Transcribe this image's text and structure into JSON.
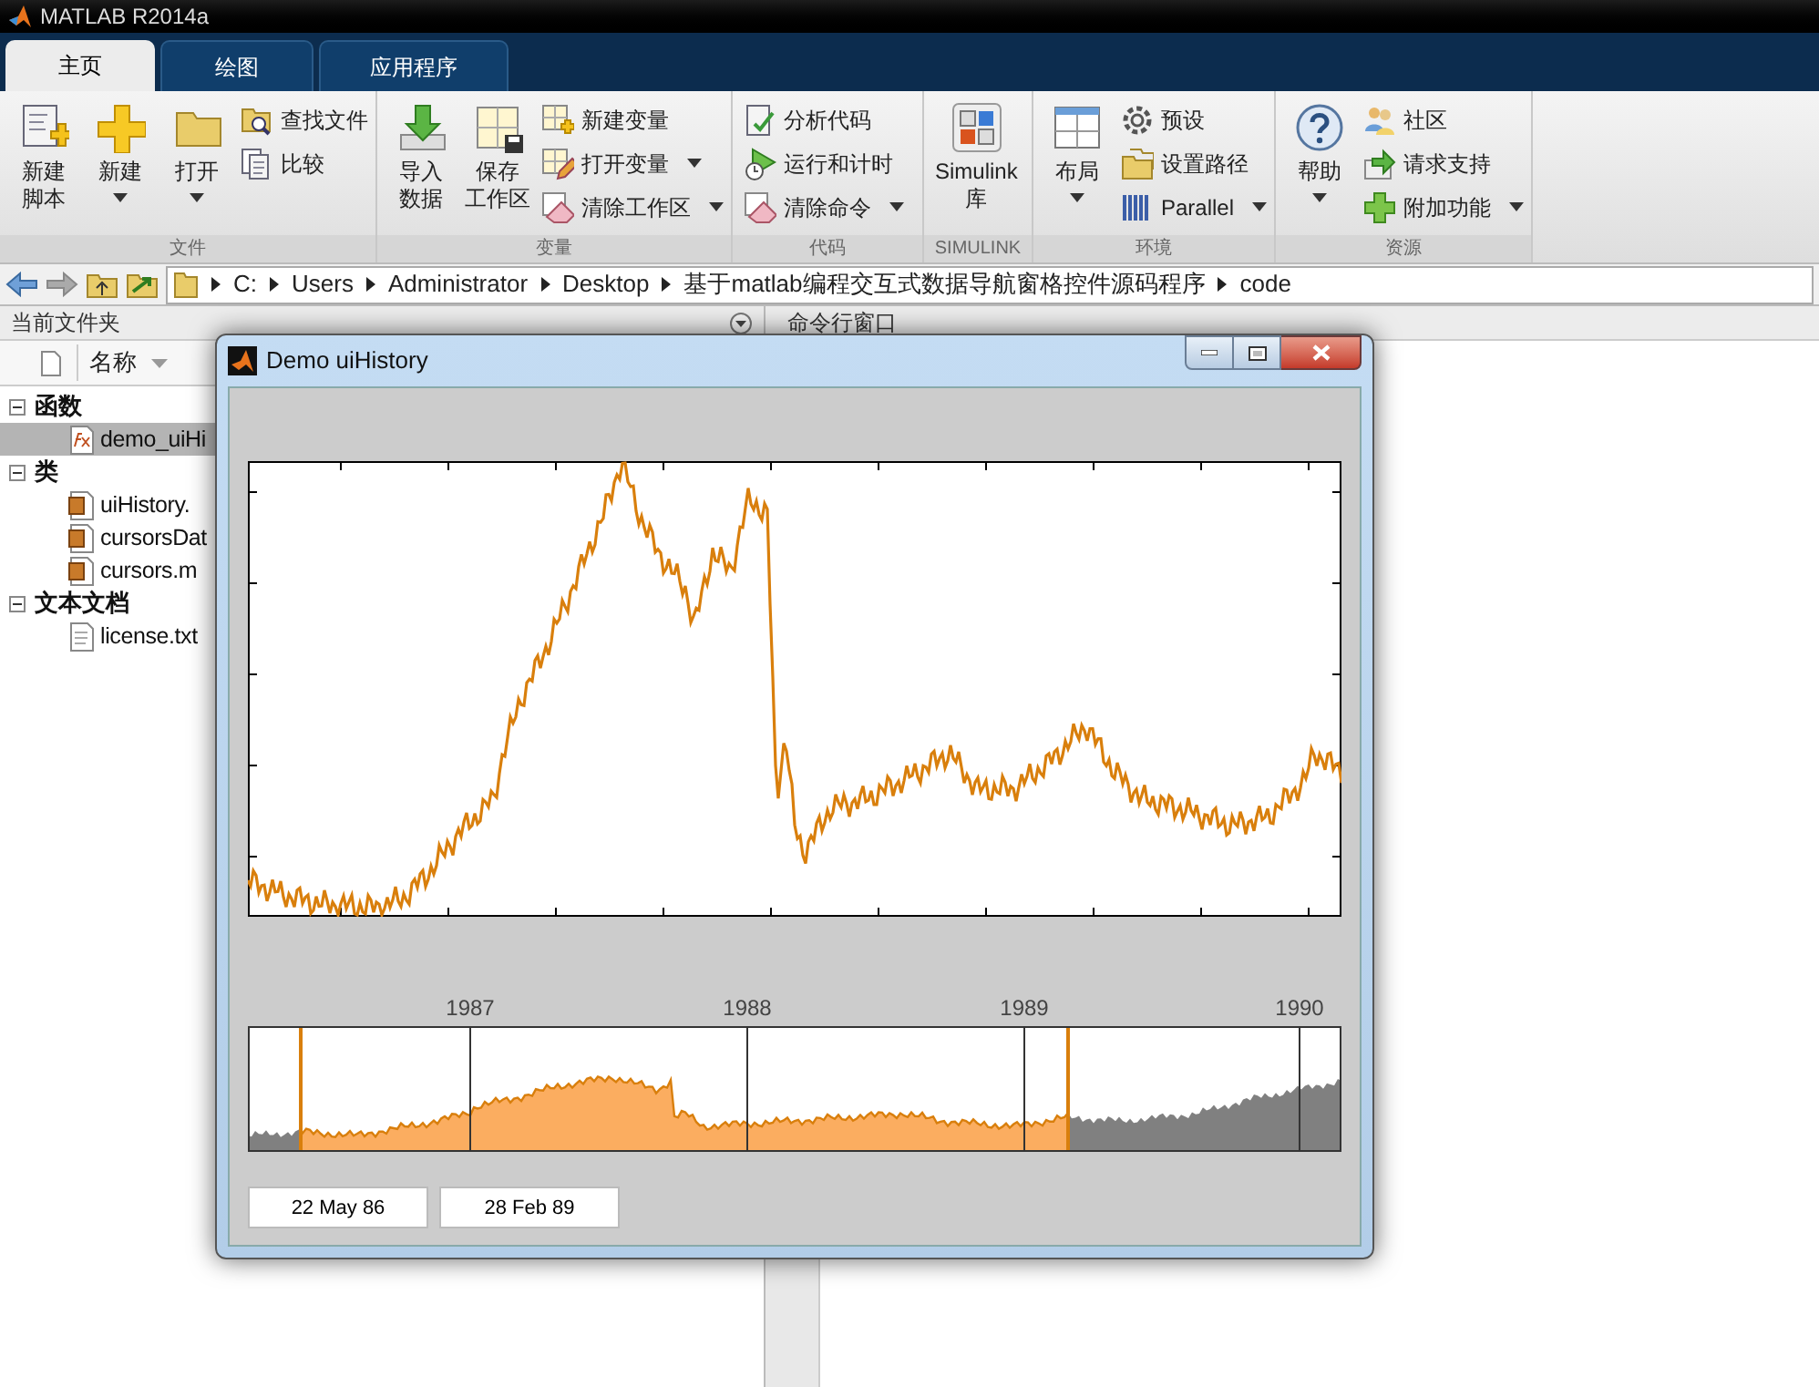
{
  "window": {
    "title": "MATLAB R2014a"
  },
  "tabs": [
    {
      "label": "主页",
      "selected": true
    },
    {
      "label": "绘图",
      "selected": false
    },
    {
      "label": "应用程序",
      "selected": false
    }
  ],
  "ribbon": {
    "groups": [
      {
        "label": "文件",
        "items": [
          {
            "kind": "large",
            "lines": [
              "新建",
              "脚本"
            ],
            "dropdown": false
          },
          {
            "kind": "large",
            "lines": [
              "新建"
            ],
            "dropdown": true
          },
          {
            "kind": "large",
            "lines": [
              "打开"
            ],
            "dropdown": true
          },
          {
            "kind": "small",
            "label": "查找文件",
            "dropdown": false
          },
          {
            "kind": "small",
            "label": "比较",
            "dropdown": false
          }
        ]
      },
      {
        "label": "变量",
        "items": [
          {
            "kind": "large",
            "lines": [
              "导入",
              "数据"
            ],
            "dropdown": false
          },
          {
            "kind": "large",
            "lines": [
              "保存",
              "工作区"
            ],
            "dropdown": false
          },
          {
            "kind": "small",
            "label": "新建变量",
            "dropdown": false
          },
          {
            "kind": "small",
            "label": "打开变量",
            "dropdown": true
          },
          {
            "kind": "small",
            "label": "清除工作区",
            "dropdown": true
          }
        ]
      },
      {
        "label": "代码",
        "items": [
          {
            "kind": "small",
            "label": "分析代码",
            "dropdown": false
          },
          {
            "kind": "small",
            "label": "运行和计时",
            "dropdown": false
          },
          {
            "kind": "small",
            "label": "清除命令",
            "dropdown": true
          }
        ]
      },
      {
        "label": "SIMULINK",
        "items": [
          {
            "kind": "large",
            "lines": [
              "Simulink",
              "库"
            ],
            "dropdown": false
          }
        ]
      },
      {
        "label": "环境",
        "items": [
          {
            "kind": "large",
            "lines": [
              "布局"
            ],
            "dropdown": true
          },
          {
            "kind": "small",
            "label": "预设",
            "dropdown": false
          },
          {
            "kind": "small",
            "label": "设置路径",
            "dropdown": false
          },
          {
            "kind": "small",
            "label": "Parallel",
            "dropdown": true
          }
        ]
      },
      {
        "label": "资源",
        "items": [
          {
            "kind": "large",
            "lines": [
              "帮助"
            ],
            "dropdown": true
          },
          {
            "kind": "small",
            "label": "社区",
            "dropdown": false
          },
          {
            "kind": "small",
            "label": "请求支持",
            "dropdown": false
          },
          {
            "kind": "small",
            "label": "附加功能",
            "dropdown": true
          }
        ]
      }
    ]
  },
  "path": [
    "C:",
    "Users",
    "Administrator",
    "Desktop",
    "基于matlab编程交互式数据导航窗格控件源码程序",
    "code"
  ],
  "current_folder": {
    "title": "当前文件夹",
    "column": "名称",
    "tree": [
      {
        "label": "函数",
        "expanded": true,
        "children": [
          {
            "label": "demo_uiHi",
            "selected": true
          }
        ]
      },
      {
        "label": "类",
        "expanded": true,
        "children": [
          {
            "label": "uiHistory.",
            "selected": false
          },
          {
            "label": "cursorsDat",
            "selected": false
          },
          {
            "label": "cursors.m",
            "selected": false
          }
        ]
      },
      {
        "label": "文本文档",
        "expanded": true,
        "children": [
          {
            "label": "license.txt",
            "selected": false
          }
        ]
      }
    ]
  },
  "command_window": {
    "title": "命令行窗口"
  },
  "figure": {
    "title": "Demo uiHistory",
    "year_labels": [
      "1987",
      "1988",
      "1989",
      "1990"
    ],
    "range_fields": [
      {
        "value": "22 May 86"
      },
      {
        "value": "28 Feb 89"
      }
    ]
  }
}
